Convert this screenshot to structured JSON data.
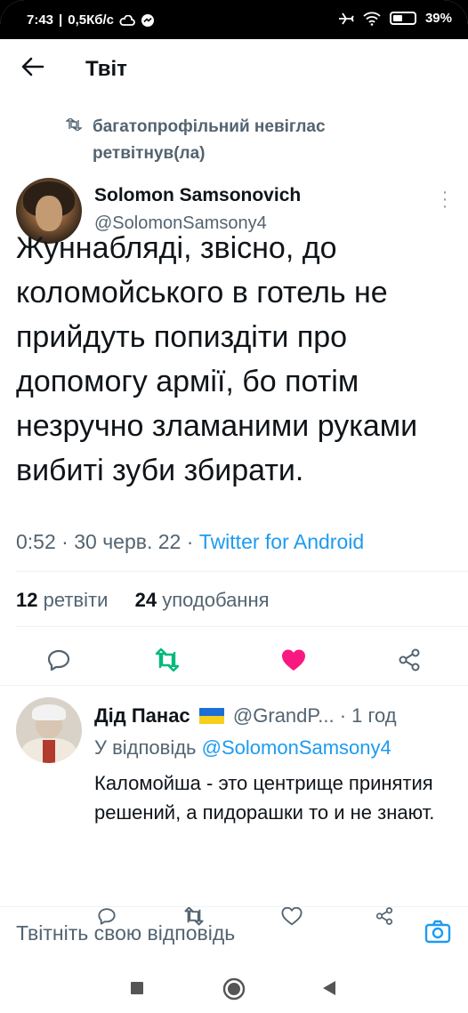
{
  "status_bar": {
    "time": "7:43",
    "speed": "0,5Кб/с",
    "battery": "39%"
  },
  "header": {
    "back_icon": "arrow-left-icon",
    "title": "Твіт"
  },
  "retweet_context": {
    "icon": "retweet-icon",
    "line1": "багатопрофільний невіглас",
    "line2": "ретвітнув(ла)"
  },
  "tweet": {
    "author_name": "Solomon Samsonovich",
    "author_handle": "@SolomonSamsony4",
    "text": "Жуннабляді, звісно, до коломойського в готель не прийдуть попиздіти про допомогу армії, бо потім незручно зламаними руками вибиті зуби збирати.",
    "time": "0:52",
    "date": "30 черв. 22",
    "source": "Twitter for Android",
    "retweets_count": "12",
    "retweets_label": "ретвіти",
    "likes_count": "24",
    "likes_label": "уподобання",
    "liked": true,
    "colors": {
      "like": "#f91880",
      "retweet": "#00ba7c",
      "link": "#1d9bf0"
    }
  },
  "reply": {
    "author_name": "Дід Панас",
    "author_handle": "@GrandP...",
    "time": "· 1 год",
    "replying_to_label": "У відповідь",
    "replying_to_handle": "@SolomonSamsony4",
    "text": "Каломойша - это центрище принятия решений, а пидорашки то и не знают."
  },
  "composer": {
    "placeholder": "Твітніть свою відповідь",
    "icon": "camera-icon"
  },
  "system_nav": [
    "square-icon",
    "circle-icon",
    "back-triangle-icon"
  ]
}
